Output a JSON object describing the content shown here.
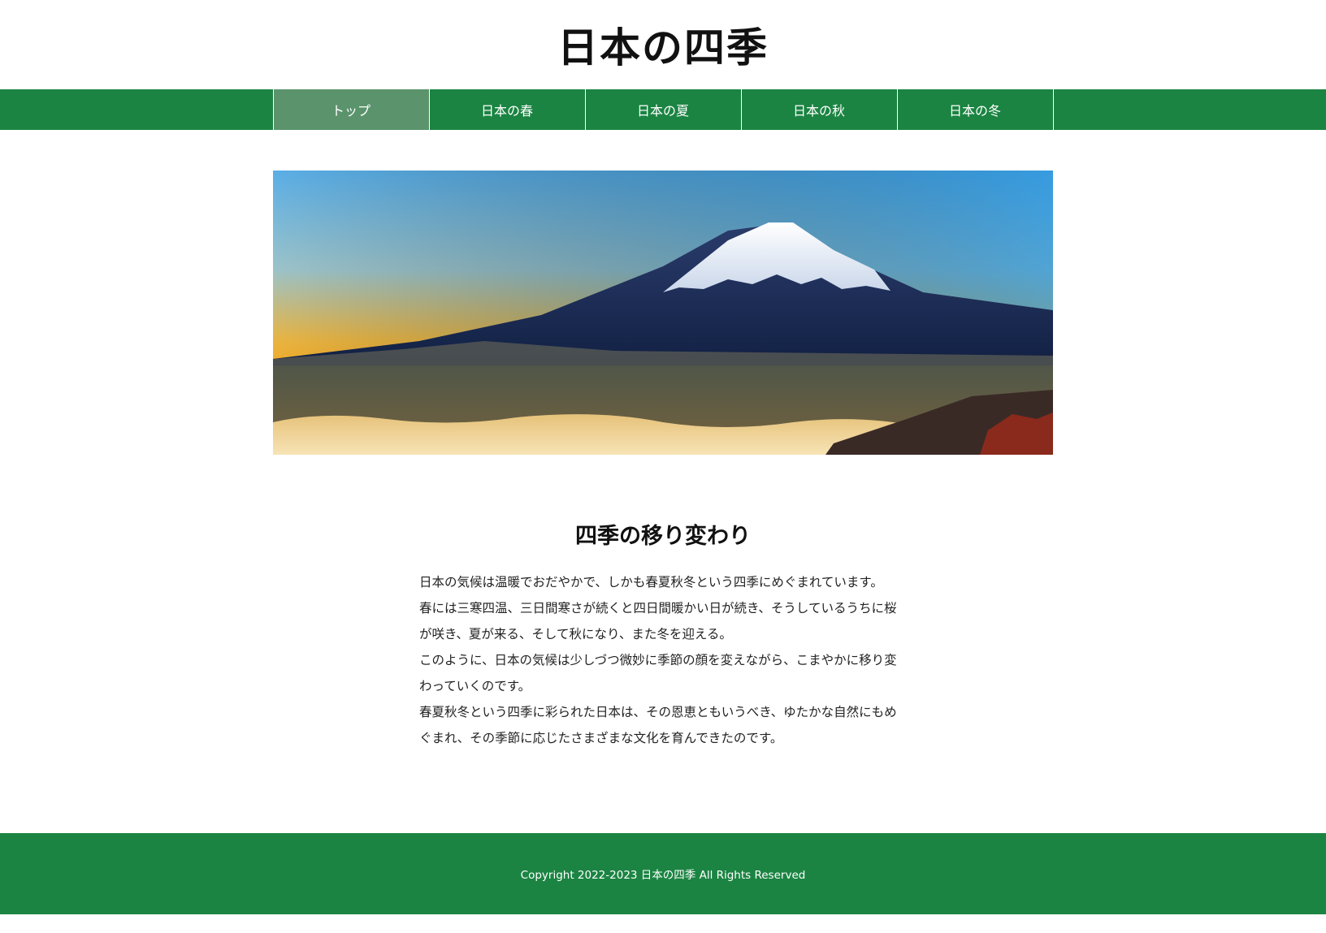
{
  "header": {
    "site_title": "日本の四季"
  },
  "nav": {
    "items": [
      {
        "label": "トップ",
        "active": true
      },
      {
        "label": "日本の春",
        "active": false
      },
      {
        "label": "日本の夏",
        "active": false
      },
      {
        "label": "日本の秋",
        "active": false
      },
      {
        "label": "日本の冬",
        "active": false
      }
    ]
  },
  "main": {
    "heading": "四季の移り変わり",
    "paragraphs": [
      "日本の気候は温暖でおだやかで、しかも春夏秋冬という四季にめぐまれています。",
      "春には三寒四温、三日間寒さが続くと四日間暖かい日が続き、そうしているうちに桜が咲き、夏が来る、そして秋になり、また冬を迎える。",
      "このように、日本の気候は少しづつ微妙に季節の顔を変えながら、こまやかに移り変わっていくのです。",
      "春夏秋冬という四季に彩られた日本は、その恩恵ともいうべき、ゆたかな自然にもめぐまれ、その季節に応じたさまざまな文化を育んできたのです。"
    ]
  },
  "footer": {
    "copyright": "Copyright 2022-2023 日本の四季 All Rights Reserved"
  },
  "colors": {
    "nav_green": "#1b8442",
    "nav_active": "#5b946c",
    "footer_green": "#1b8442"
  }
}
